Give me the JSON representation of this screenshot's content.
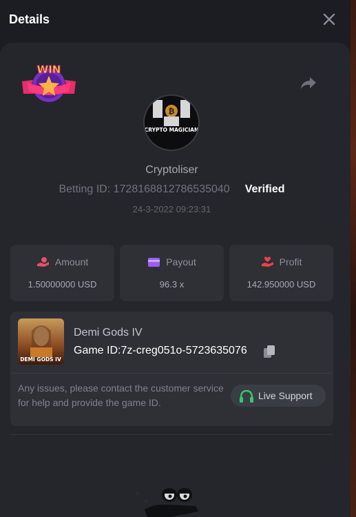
{
  "header": {
    "title": "Details"
  },
  "profile": {
    "avatar_caption": "CRYPTO MAGICIAN",
    "username": "Cryptoliser",
    "betting_id_label": "Betting ID:",
    "betting_id": "1728168812786535040",
    "verified": "Verified",
    "timestamp": "24-3-2022 09:23:31"
  },
  "badge": {
    "text": "WIN"
  },
  "stats": [
    {
      "label": "Amount",
      "value": "1.50000000 USD",
      "icon": "hand-coin-icon"
    },
    {
      "label": "Payout",
      "value": "96.3 x",
      "icon": "card-icon"
    },
    {
      "label": "Profit",
      "value": "142.950000 USD",
      "icon": "hand-heart-icon"
    }
  ],
  "game": {
    "name": "Demi Gods IV",
    "thumb_text": "DEMI GODS IV",
    "id_label": "Game ID:",
    "id": "7z-creg051o-5723635076",
    "issue_text": "Any issues, please contact the customer service for help and provide the game ID.",
    "support_label": "Live Support"
  },
  "colors": {
    "accent_green": "#2ecc71",
    "amount_icon": "#e8506a",
    "payout_icon": "#9b5cf6",
    "profit_icon": "#e8434a"
  }
}
